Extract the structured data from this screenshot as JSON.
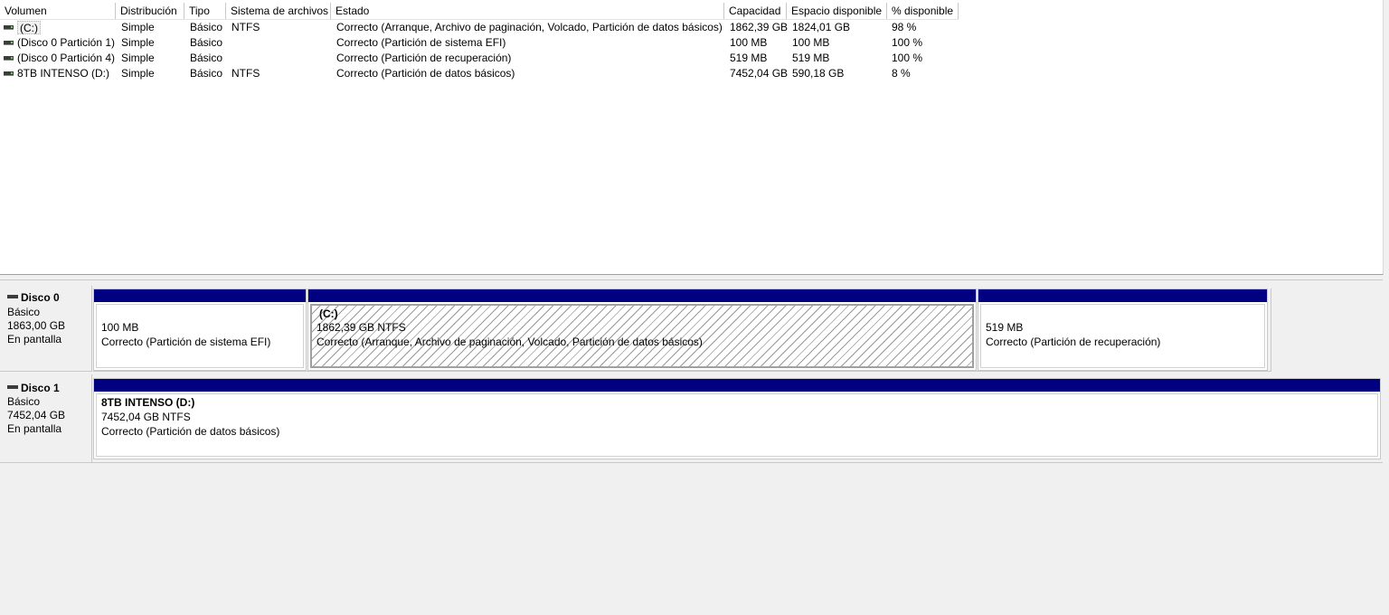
{
  "columns": [
    "Volumen",
    "Distribución",
    "Tipo",
    "Sistema de archivos",
    "Estado",
    "Capacidad",
    "Espacio disponible",
    "% disponible"
  ],
  "volumes": [
    {
      "name": "(C:)",
      "layout": "Simple",
      "type": "Básico",
      "fs": "NTFS",
      "status": "Correcto (Arranque, Archivo de paginación, Volcado, Partición de datos básicos)",
      "capacity": "1862,39 GB",
      "free": "1824,01 GB",
      "pct": "98 %"
    },
    {
      "name": "(Disco 0 Partición 1)",
      "layout": "Simple",
      "type": "Básico",
      "fs": "",
      "status": "Correcto (Partición de sistema EFI)",
      "capacity": "100 MB",
      "free": "100 MB",
      "pct": "100 %"
    },
    {
      "name": "(Disco 0 Partición 4)",
      "layout": "Simple",
      "type": "Básico",
      "fs": "",
      "status": "Correcto (Partición de recuperación)",
      "capacity": "519 MB",
      "free": "519 MB",
      "pct": "100 %"
    },
    {
      "name": "8TB INTENSO (D:)",
      "layout": "Simple",
      "type": "Básico",
      "fs": "NTFS",
      "status": "Correcto (Partición de datos básicos)",
      "capacity": "7452,04 GB",
      "free": "590,18 GB",
      "pct": "8 %"
    }
  ],
  "disks": [
    {
      "title": "Disco 0",
      "kind": "Básico",
      "size": "1863,00 GB",
      "state": "En pantalla",
      "partitions": [
        {
          "label": "",
          "size": "100 MB",
          "status": "Correcto (Partición de sistema EFI)"
        },
        {
          "label": "(C:)",
          "size": "1862,39 GB NTFS",
          "status": "Correcto (Arranque, Archivo de paginación, Volcado, Partición de datos básicos)"
        },
        {
          "label": "",
          "size": "519 MB",
          "status": "Correcto (Partición de recuperación)"
        }
      ]
    },
    {
      "title": "Disco 1",
      "kind": "Básico",
      "size": "7452,04 GB",
      "state": "En pantalla",
      "partitions": [
        {
          "label": "8TB INTENSO  (D:)",
          "size": "7452,04 GB NTFS",
          "status": "Correcto (Partición de datos básicos)"
        }
      ]
    }
  ],
  "colors": {
    "partition_bar": "#000080",
    "background": "#f0f0f0"
  },
  "icons": {
    "volume": "drive-icon",
    "disk": "disk-icon"
  }
}
